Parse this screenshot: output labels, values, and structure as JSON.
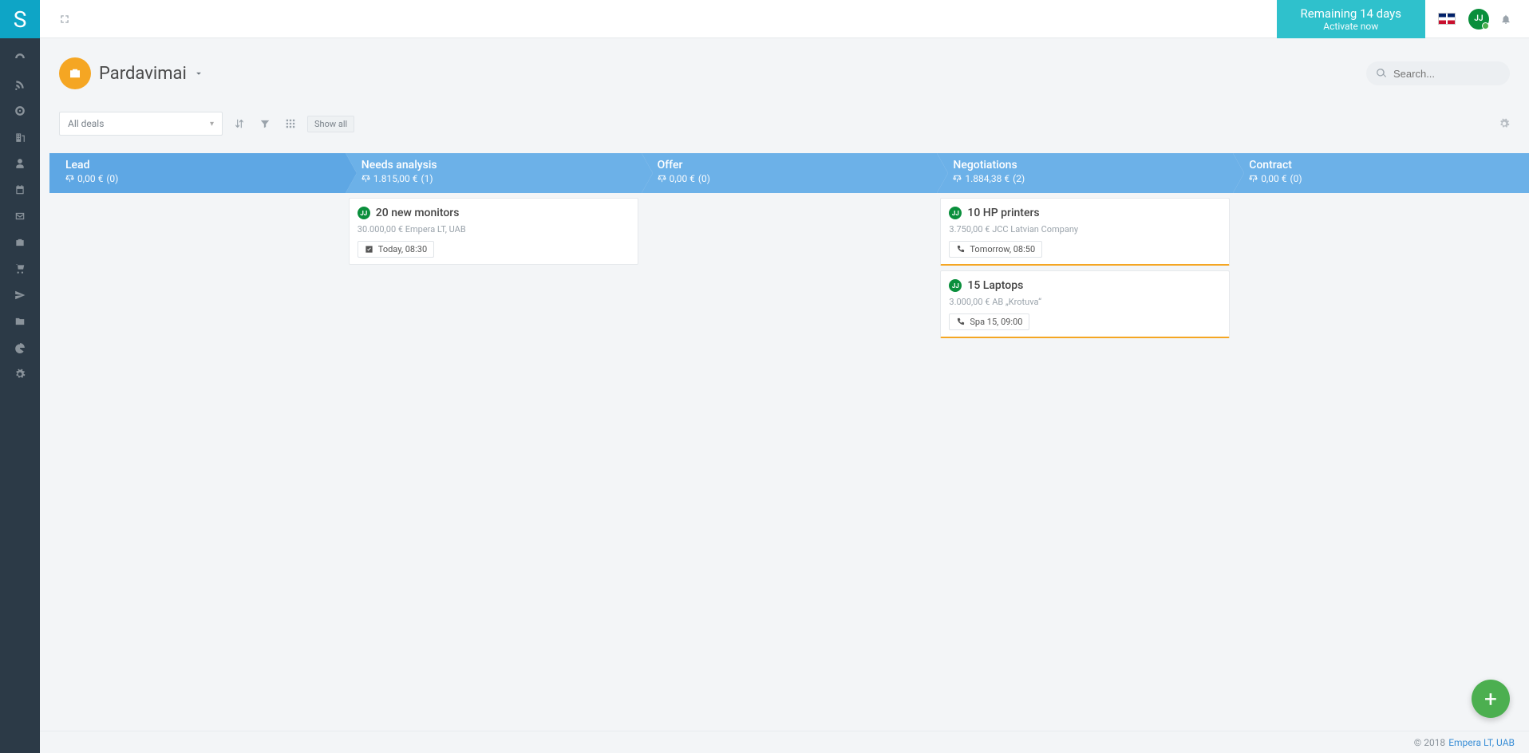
{
  "brand": {
    "letter": "S"
  },
  "topbar": {
    "trial_line1": "Remaining 14 days",
    "trial_line2": "Activate now",
    "avatar_initials": "JJ"
  },
  "page": {
    "title": "Pardavimai"
  },
  "search": {
    "placeholder": "Search..."
  },
  "toolbar": {
    "filter_dropdown": "All deals",
    "show_all": "Show all"
  },
  "stages": [
    {
      "name": "Lead",
      "amount": "0,00 €",
      "count": "(0)"
    },
    {
      "name": "Needs analysis",
      "amount": "1.815,00 €",
      "count": "(1)"
    },
    {
      "name": "Offer",
      "amount": "0,00 €",
      "count": "(0)"
    },
    {
      "name": "Negotiations",
      "amount": "1.884,38 €",
      "count": "(2)"
    },
    {
      "name": "Contract",
      "amount": "0,00 €",
      "count": "(0)"
    }
  ],
  "cards": {
    "needs_analysis": [
      {
        "initials": "JJ",
        "title": "20 new monitors",
        "sub": "30.000,00 € Empera LT, UAB",
        "activity_icon": "check",
        "activity": "Today, 08:30",
        "accent": false
      }
    ],
    "negotiations": [
      {
        "initials": "JJ",
        "title": "10 HP printers",
        "sub": "3.750,00 € JCC Latvian Company",
        "activity_icon": "phone",
        "activity": "Tomorrow, 08:50",
        "accent": true
      },
      {
        "initials": "JJ",
        "title": "15 Laptops",
        "sub": "3.000,00 € AB „Krotuva“",
        "activity_icon": "phone",
        "activity": "Spa 15, 09:00",
        "accent": true
      }
    ]
  },
  "footer": {
    "copyright": "© 2018",
    "company": "Empera LT, UAB"
  }
}
